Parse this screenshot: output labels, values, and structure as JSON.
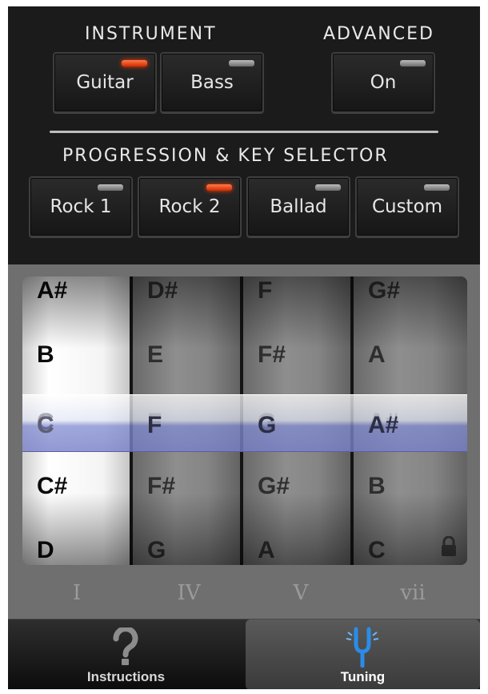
{
  "instrument": {
    "header": "INSTRUMENT",
    "options": [
      {
        "label": "Guitar",
        "selected": true
      },
      {
        "label": "Bass",
        "selected": false
      }
    ]
  },
  "advanced": {
    "header": "ADVANCED",
    "button_label": "On"
  },
  "progression": {
    "header": "PROGRESSION  & KEY SELECTOR",
    "options": [
      {
        "label": "Rock 1",
        "selected": false
      },
      {
        "label": "Rock 2",
        "selected": true
      },
      {
        "label": "Ballad",
        "selected": false
      },
      {
        "label": "Custom",
        "selected": false
      }
    ]
  },
  "picker": {
    "columns": [
      {
        "notes": [
          "A#",
          "B",
          "C",
          "C#",
          "D"
        ],
        "selected": "C"
      },
      {
        "notes": [
          "D#",
          "E",
          "F",
          "F#",
          "G"
        ],
        "selected": "F"
      },
      {
        "notes": [
          "F",
          "F#",
          "G",
          "G#",
          "A"
        ],
        "selected": "G"
      },
      {
        "notes": [
          "G#",
          "A",
          "A#",
          "B",
          "C"
        ],
        "selected": "A#"
      }
    ],
    "degrees": [
      "I",
      "IV",
      "V",
      "vii"
    ],
    "last_column_locked": true
  },
  "tabbar": {
    "tabs": [
      {
        "label": "Instructions",
        "icon": "question-mark-icon",
        "active": false
      },
      {
        "label": "Tuning",
        "icon": "tuning-fork-icon",
        "active": true
      }
    ]
  },
  "colors": {
    "led_on": "#ff4a14",
    "led_off": "#9a9a9a",
    "selection_band": "#7f88cc"
  }
}
